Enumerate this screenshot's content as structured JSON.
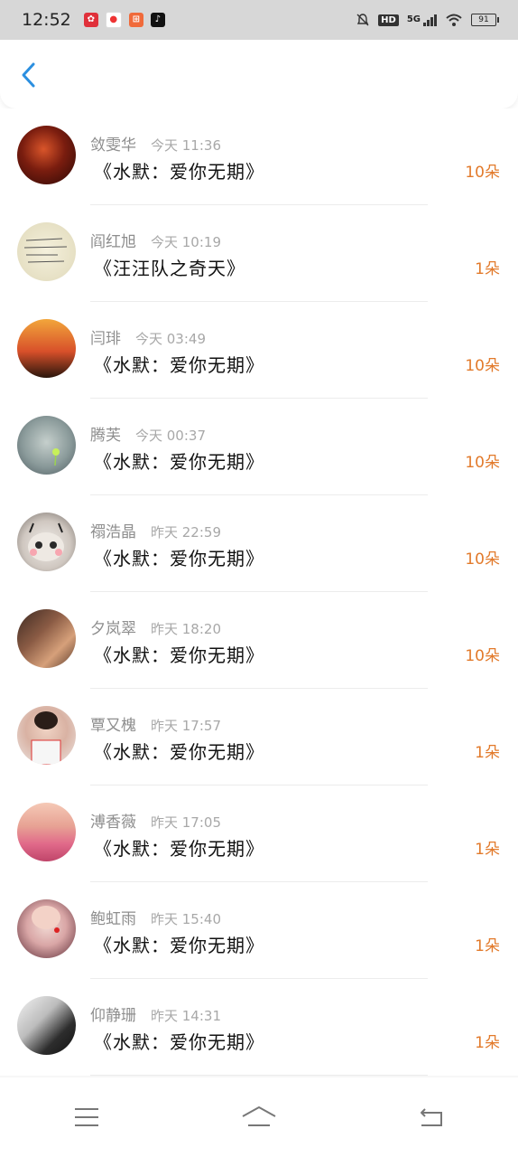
{
  "status": {
    "time": "12:52",
    "network": "5G",
    "hd": "HD",
    "battery": "91",
    "app_icons": [
      "app-icon-red",
      "app-icon-pin",
      "app-icon-orange",
      "app-icon-tiktok"
    ]
  },
  "header": {
    "back_icon": "chevron-left-icon",
    "back_color": "#2b8fe0"
  },
  "colors": {
    "count": "#e27a2b",
    "name": "#8e8e8e",
    "song": "#111111"
  },
  "items": [
    {
      "name": "敛雯华",
      "time": "今天 11:36",
      "song": "《水默：爱你无期》",
      "count": "10朵",
      "avatar": "avatar-dark-red"
    },
    {
      "name": "阎红旭",
      "time": "今天 10:19",
      "song": "《汪汪队之奇天》",
      "count": "1朵",
      "avatar": "avatar-handwriting"
    },
    {
      "name": "闫琲",
      "time": "今天 03:49",
      "song": "《水默：爱你无期》",
      "count": "10朵",
      "avatar": "avatar-sunset"
    },
    {
      "name": "腾芙",
      "time": "今天 00:37",
      "song": "《水默：爱你无期》",
      "count": "10朵",
      "avatar": "avatar-dew"
    },
    {
      "name": "禤浩晶",
      "time": "昨天 22:59",
      "song": "《水默：爱你无期》",
      "count": "10朵",
      "avatar": "avatar-cat"
    },
    {
      "name": "夕岚翠",
      "time": "昨天 18:20",
      "song": "《水默：爱你无期》",
      "count": "10朵",
      "avatar": "avatar-woman"
    },
    {
      "name": "覃又槐",
      "time": "昨天 17:57",
      "song": "《水默：爱你无期》",
      "count": "1朵",
      "avatar": "avatar-player"
    },
    {
      "name": "溥香薇",
      "time": "昨天 17:05",
      "song": "《水默：爱你无期》",
      "count": "1朵",
      "avatar": "avatar-blossom"
    },
    {
      "name": "鲍虹雨",
      "time": "昨天 15:40",
      "song": "《水默：爱你无期》",
      "count": "1朵",
      "avatar": "avatar-singer"
    },
    {
      "name": "仰静珊",
      "time": "昨天 14:31",
      "song": "《水默：爱你无期》",
      "count": "1朵",
      "avatar": "avatar-bw-portrait"
    }
  ],
  "nav": {
    "menu_icon": "menu-icon",
    "home_icon": "home-icon",
    "back_icon": "return-icon"
  }
}
